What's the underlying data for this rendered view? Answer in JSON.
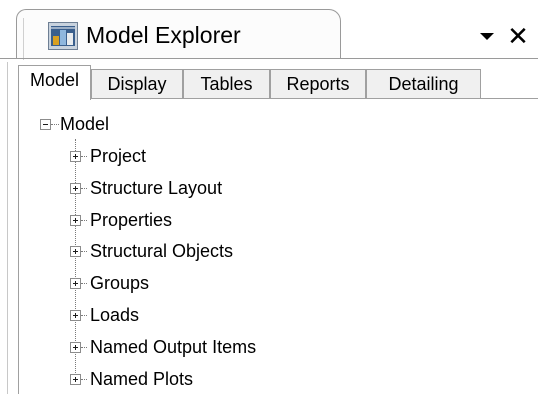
{
  "panel": {
    "title": "Model Explorer",
    "title_icon": "model-explorer-icon",
    "dropdown_icon": "dropdown-triangle-icon",
    "close_icon": "close-icon",
    "close_glyph": "✕"
  },
  "tabs": [
    {
      "label": "Model",
      "active": true
    },
    {
      "label": "Display",
      "active": false
    },
    {
      "label": "Tables",
      "active": false
    },
    {
      "label": "Reports",
      "active": false
    },
    {
      "label": "Detailing",
      "active": false
    }
  ],
  "tree": {
    "root": {
      "label": "Model",
      "expanded": true
    },
    "children": [
      {
        "label": "Project",
        "expanded": false
      },
      {
        "label": "Structure Layout",
        "expanded": false
      },
      {
        "label": "Properties",
        "expanded": false
      },
      {
        "label": "Structural Objects",
        "expanded": false
      },
      {
        "label": "Groups",
        "expanded": false
      },
      {
        "label": "Loads",
        "expanded": false
      },
      {
        "label": "Named Output Items",
        "expanded": false
      },
      {
        "label": "Named Plots",
        "expanded": false
      }
    ]
  },
  "colors": {
    "border": "#a0a0a0",
    "tab_inactive_bg": "#f0f0f0",
    "background": "#ffffff",
    "text": "#000000"
  }
}
